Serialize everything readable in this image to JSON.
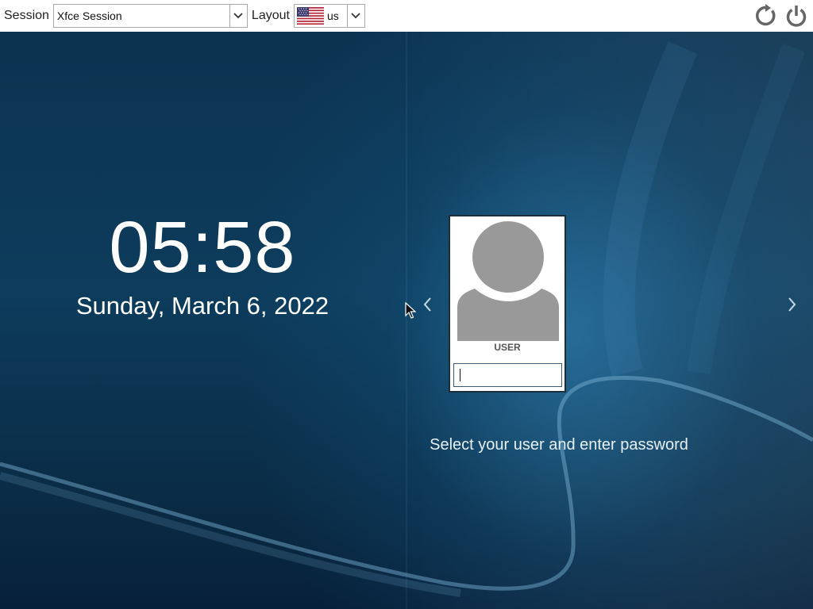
{
  "topbar": {
    "session_label": "Session",
    "session_value": "Xfce Session",
    "layout_label": "Layout",
    "layout_value": "us",
    "flag_icon": "us-flag-icon",
    "restart_icon": "restart-icon",
    "shutdown_icon": "power-icon"
  },
  "clock": {
    "time": "05:58",
    "date": "Sunday, March 6, 2022"
  },
  "user_selector": {
    "username": "USER",
    "password_value": "",
    "hint": "Select your user and enter password",
    "prev_icon": "chevron-left-icon",
    "next_icon": "chevron-right-icon"
  },
  "colors": {
    "topbar_bg": "#ffffff",
    "background": "#0d3c5c",
    "accent_glow": "#2878aa",
    "text_light": "#ffffff",
    "avatar_gray": "#999999",
    "icon_gray": "#666666"
  }
}
